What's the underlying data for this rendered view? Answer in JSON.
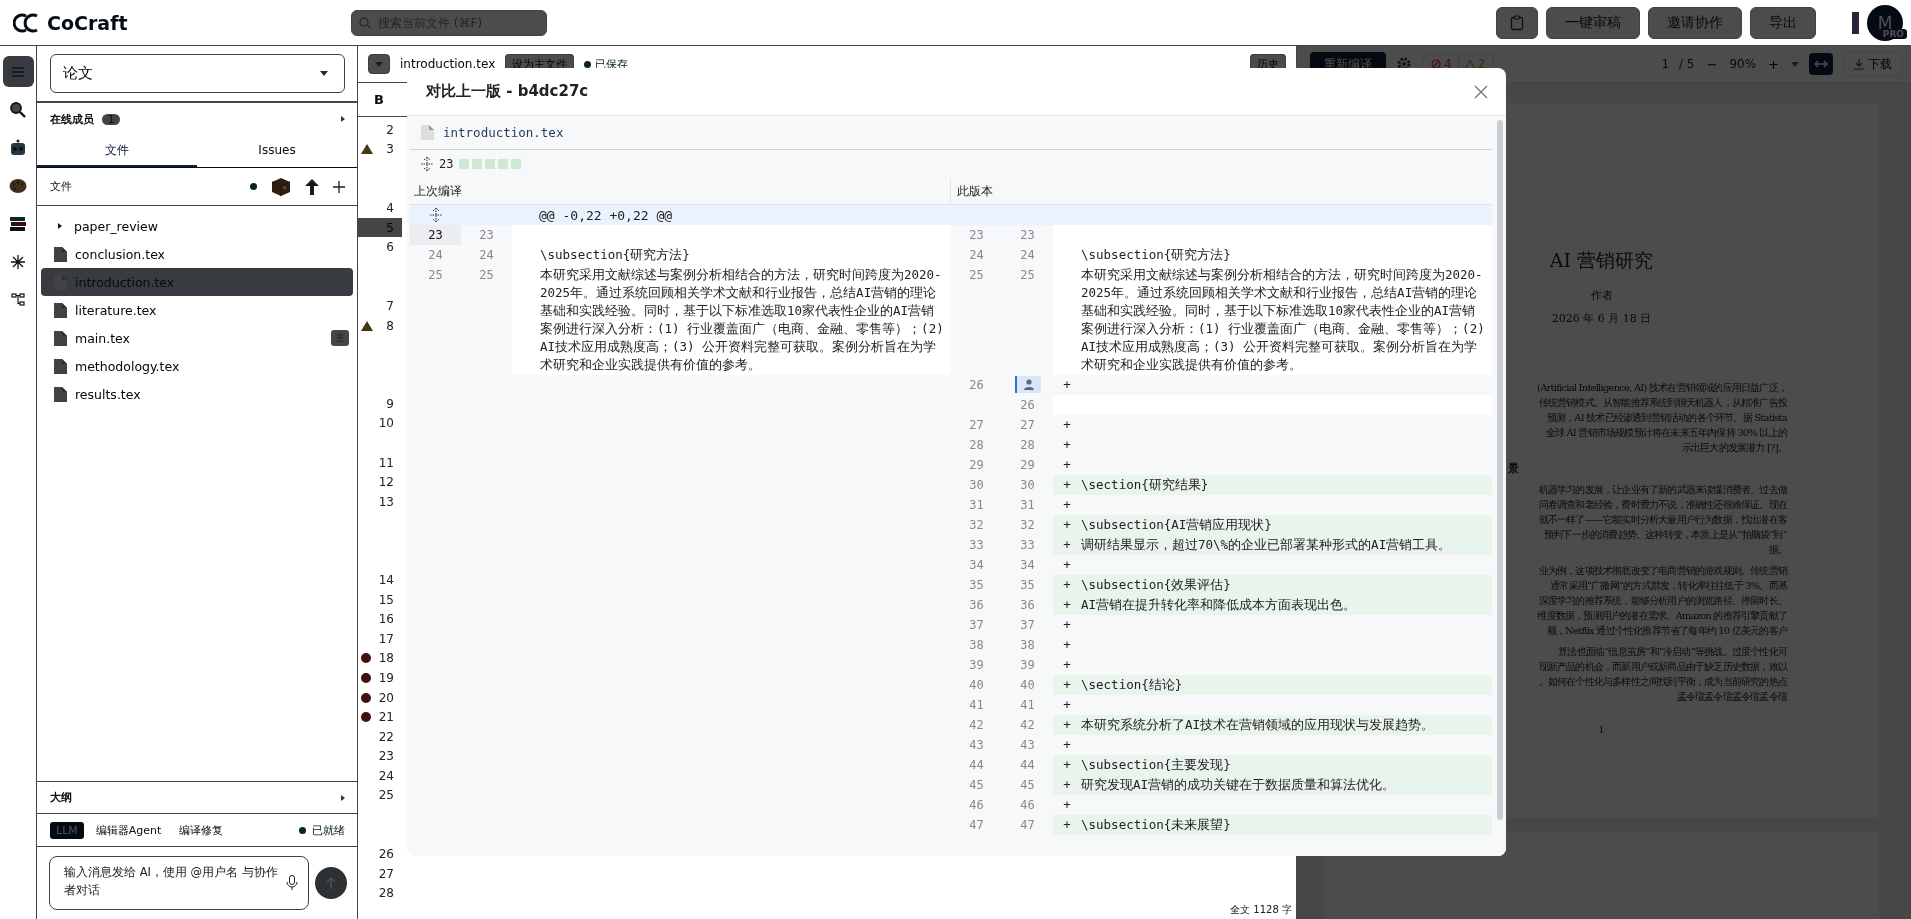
{
  "app": {
    "logo": "CoCraft",
    "search_placeholder": "搜索当前文件 (⌘F)",
    "actions": [
      "一键审稿",
      "邀请协作",
      "导出"
    ],
    "avatar": "M",
    "plan_badge": "PRO"
  },
  "rail": [
    {
      "kind": "menu",
      "selected": true
    },
    {
      "kind": "search",
      "selected": false
    },
    {
      "kind": "robot",
      "selected": false
    },
    {
      "kind": "palette",
      "selected": false
    },
    {
      "kind": "books",
      "selected": false
    },
    {
      "kind": "sparkle",
      "selected": false
    },
    {
      "kind": "hierarchy",
      "selected": false
    }
  ],
  "sidebar": {
    "project": "论文",
    "members_label": "在线成员",
    "members_count": "1",
    "tabs": [
      {
        "label": "文件",
        "selected": true
      },
      {
        "label": "Issues",
        "selected": false
      }
    ],
    "files_label": "文件",
    "files": [
      {
        "kind": "folder",
        "name": "paper_review",
        "expanded": false,
        "selected": false
      },
      {
        "kind": "file",
        "name": "conclusion.tex",
        "selected": false
      },
      {
        "kind": "file",
        "name": "introduction.tex",
        "selected": true
      },
      {
        "kind": "file",
        "name": "literature.tex",
        "selected": false
      },
      {
        "kind": "file",
        "name": "main.tex",
        "badge": "主",
        "selected": false
      },
      {
        "kind": "file",
        "name": "methodology.tex",
        "selected": false
      },
      {
        "kind": "file",
        "name": "results.tex",
        "selected": false
      }
    ],
    "outline": "大纲",
    "chat_modes": [
      {
        "label": "LLM",
        "selected": true
      },
      {
        "label": "编辑器Agent",
        "selected": false
      },
      {
        "label": "编译修复",
        "selected": false
      }
    ],
    "chat_status": "已就绪",
    "chat_placeholder": "输入消息发给 AI，使用 @用户名 与协作者对话"
  },
  "editor": {
    "file": "introduction.tex",
    "set_main": "设为主文件",
    "save_status": "已保存",
    "history": "历史",
    "format_label": "B",
    "word_count": "全文 1128 字",
    "gutter": [
      {
        "kind": "line",
        "number": "2",
        "active": false
      },
      {
        "kind": "warning",
        "number": "3",
        "active": false
      },
      {
        "kind": "wrap"
      },
      {
        "kind": "wrap"
      },
      {
        "kind": "line",
        "number": "4",
        "active": false
      },
      {
        "kind": "line",
        "number": "5",
        "active": true
      },
      {
        "kind": "line",
        "number": "6",
        "active": false
      },
      {
        "kind": "wrap"
      },
      {
        "kind": "wrap"
      },
      {
        "kind": "line",
        "number": "7",
        "active": false
      },
      {
        "kind": "warning",
        "number": "8",
        "active": false
      },
      {
        "kind": "wrap"
      },
      {
        "kind": "wrap"
      },
      {
        "kind": "wrap"
      },
      {
        "kind": "line",
        "number": "9",
        "active": false
      },
      {
        "kind": "line",
        "number": "10",
        "active": false
      },
      {
        "kind": "wrap"
      },
      {
        "kind": "line",
        "number": "11",
        "active": false
      },
      {
        "kind": "line",
        "number": "12",
        "active": false
      },
      {
        "kind": "line",
        "number": "13",
        "active": false
      },
      {
        "kind": "wrap"
      },
      {
        "kind": "wrap"
      },
      {
        "kind": "wrap"
      },
      {
        "kind": "line",
        "number": "14",
        "active": false
      },
      {
        "kind": "line",
        "number": "15",
        "active": false
      },
      {
        "kind": "line",
        "number": "16",
        "active": false
      },
      {
        "kind": "line",
        "number": "17",
        "active": false
      },
      {
        "kind": "error",
        "number": "18",
        "active": false
      },
      {
        "kind": "error",
        "number": "19",
        "active": false
      },
      {
        "kind": "error",
        "number": "20",
        "active": false
      },
      {
        "kind": "error",
        "number": "21",
        "active": false
      },
      {
        "kind": "line",
        "number": "22",
        "active": false
      },
      {
        "kind": "line",
        "number": "23",
        "active": false
      },
      {
        "kind": "line",
        "number": "24",
        "active": false
      },
      {
        "kind": "line",
        "number": "25",
        "active": false
      },
      {
        "kind": "wrap"
      },
      {
        "kind": "wrap"
      },
      {
        "kind": "line",
        "number": "26",
        "active": false
      },
      {
        "kind": "line",
        "number": "27",
        "active": false
      },
      {
        "kind": "line",
        "number": "28",
        "active": false
      }
    ]
  },
  "pdf": {
    "recompile": "重新编译",
    "errors": "4",
    "warnings": "2",
    "page_input": "1",
    "page_total": "/ 5",
    "minus": "−",
    "zoom": "90%",
    "plus": "+",
    "fit_width_on": true,
    "download": "下载",
    "title": "AI 营销研究",
    "author": "作者",
    "date": "2026 年 6 月 18 日",
    "heading": "景",
    "page_number": "1",
    "paragraphs": [
      [
        "(Artificial Intelligence, AI) 技术在营销领域的应用日益广泛，",
        "传统营销模式。从智能推荐系统到聊天机器人，从精准广告投",
        "预测，AI 技术已经渗透到营销活动的各个环节。据 Statista",
        "全球 AI 营销市场规模预计将在未来五年内保持 30% 以上的",
        "示出巨大的发展潜力 [?]。"
      ],
      [
        "机器学习的发展，让企业有了新的武器来读懂消费者。过去做",
        "问卷调查和老经验，费时费力不说，准确性还很难保证。现在",
        "就不一样了——它能实时分析大量用户行为数据，找出潜在客",
        "预判下一步的消费趋势。这种转变，本质上是从“拍脑袋”到“",
        "据。"
      ],
      [
        "业为例，这项技术彻底改变了电商营销的游戏规则。传统营销",
        "通常采用“广撒网”的方式群发，转化率往往低于 3%。而基",
        "深度学习的推荐系统，能够分析用户的浏览路径、停留时长、",
        "维度数据，预测用户的潜在需求。Amazon 的推荐引擎贡献了",
        "额，Netflix 通过个性化推荐节省了每年约 10 亿美元的客户"
      ],
      [
        "算法也面临“信息茧房”和“冷启动”等挑战。过度个性化可",
        "现新产品的机会，而新用户或新商品由于缺乏历史数据，难以",
        "。如何在个性化与多样性之间找到平衡，成为当前研究的热点",
        "孟令瑄孟令瑄孟令瑄孟令瑄"
      ]
    ]
  },
  "diff_modal": {
    "title": "对比上一版 - b4dc27c",
    "file": "introduction.tex",
    "hunk_lines": "23",
    "left_title": "上次编译",
    "right_title": "此版本",
    "hunk_header": "@@ -0,22 +0,22 @@",
    "left_rows": [
      {
        "old": "23",
        "new": "23",
        "active": true
      },
      {
        "old": "24",
        "new": "24",
        "text": "\\subsection{研究方法}",
        "active": false
      },
      {
        "old": "25",
        "new": "25",
        "text": "本研究采用文献综述与案例分析相结合的方法，研究时间跨度为2020-2025年。通过系统回顾相关学术文献和行业报告，总结AI营销的理论基础和实践经验。同时，基于以下标准选取10家代表性企业的AI营销案例进行深入分析：(1) 行业覆盖面广（电商、金融、零售等）；(2) AI技术应用成熟度高；(3) 公开资料完整可获取。案例分析旨在为学术研究和企业实践提供有价值的参考。",
        "active": false
      }
    ],
    "right_rows": [
      {
        "kind": "context",
        "old": "23",
        "new": "23"
      },
      {
        "kind": "context",
        "old": "24",
        "new": "24",
        "text": "\\subsection{研究方法}"
      },
      {
        "kind": "context",
        "old": "25",
        "new": "25",
        "text": "本研究采用文献综述与案例分析相结合的方法，研究时间跨度为2020-2025年。通过系统回顾相关学术文献和行业报告，总结AI营销的理论基础和实践经验。同时，基于以下标准选取10家代表性企业的AI营销案例进行深入分析：(1) 行业覆盖面广（电商、金融、零售等）；(2) AI技术应用成熟度高；(3) 公开资料完整可获取。案例分析旨在为学术研究和企业实践提供有价值的参考。"
      },
      {
        "kind": "annotated",
        "old": "26",
        "sign": "+"
      },
      {
        "kind": "context",
        "new": "26"
      },
      {
        "kind": "added",
        "old": "27",
        "new": "27",
        "sign": "+"
      },
      {
        "kind": "added",
        "old": "28",
        "new": "28",
        "sign": "+"
      },
      {
        "kind": "added",
        "old": "29",
        "new": "29",
        "sign": "+"
      },
      {
        "kind": "added",
        "old": "30",
        "new": "30",
        "sign": "+",
        "text": "\\section{研究结果}"
      },
      {
        "kind": "added",
        "old": "31",
        "new": "31",
        "sign": "+"
      },
      {
        "kind": "added",
        "old": "32",
        "new": "32",
        "sign": "+",
        "text": "\\subsection{AI营销应用现状}"
      },
      {
        "kind": "added",
        "old": "33",
        "new": "33",
        "sign": "+",
        "text": "调研结果显示，超过70\\%的企业已部署某种形式的AI营销工具。"
      },
      {
        "kind": "added",
        "old": "34",
        "new": "34",
        "sign": "+"
      },
      {
        "kind": "added",
        "old": "35",
        "new": "35",
        "sign": "+",
        "text": "\\subsection{效果评估}"
      },
      {
        "kind": "added",
        "old": "36",
        "new": "36",
        "sign": "+",
        "text": "AI营销在提升转化率和降低成本方面表现出色。"
      },
      {
        "kind": "added",
        "old": "37",
        "new": "37",
        "sign": "+"
      },
      {
        "kind": "added",
        "old": "38",
        "new": "38",
        "sign": "+"
      },
      {
        "kind": "added",
        "old": "39",
        "new": "39",
        "sign": "+"
      },
      {
        "kind": "added",
        "old": "40",
        "new": "40",
        "sign": "+",
        "text": "\\section{结论}"
      },
      {
        "kind": "added",
        "old": "41",
        "new": "41",
        "sign": "+"
      },
      {
        "kind": "added",
        "old": "42",
        "new": "42",
        "sign": "+",
        "text": "本研究系统分析了AI技术在营销领域的应用现状与发展趋势。"
      },
      {
        "kind": "added",
        "old": "43",
        "new": "43",
        "sign": "+"
      },
      {
        "kind": "added",
        "old": "44",
        "new": "44",
        "sign": "+",
        "text": "\\subsection{主要发现}"
      },
      {
        "kind": "added",
        "old": "45",
        "new": "45",
        "sign": "+",
        "text": "研究发现AI营销的成功关键在于数据质量和算法优化。"
      },
      {
        "kind": "added",
        "old": "46",
        "new": "46",
        "sign": "+"
      },
      {
        "kind": "added",
        "old": "47",
        "new": "47",
        "sign": "+",
        "text": "\\subsection{未来展望}"
      }
    ]
  }
}
